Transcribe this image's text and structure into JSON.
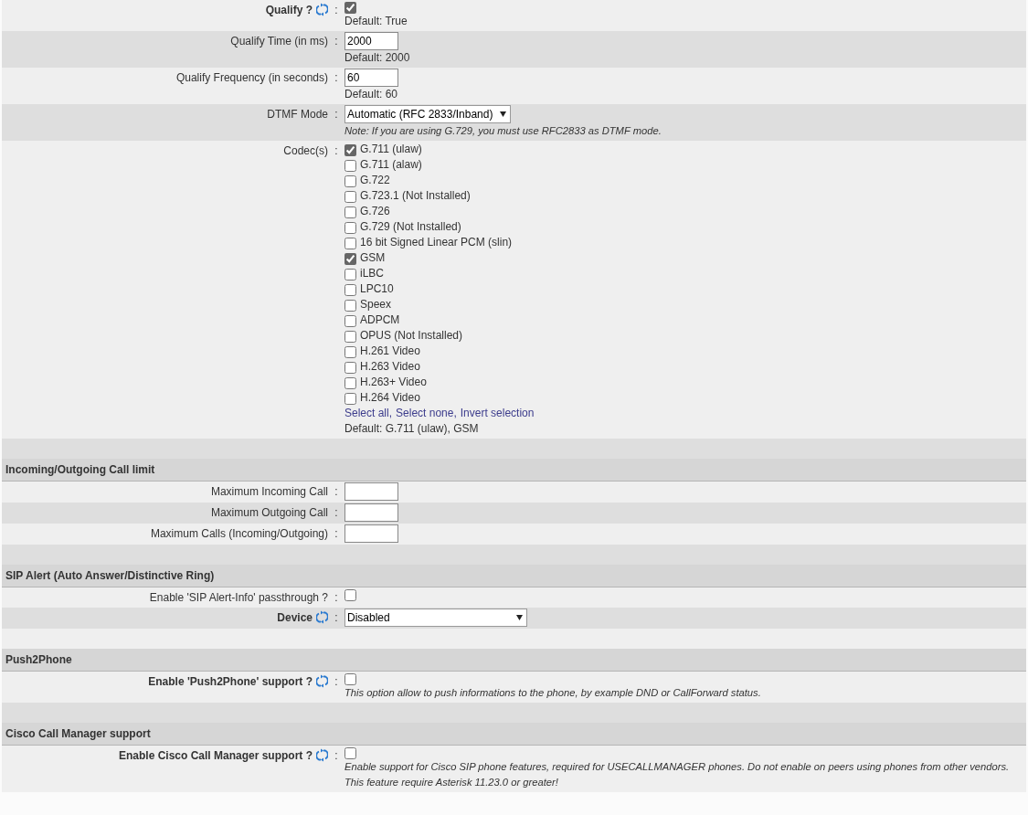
{
  "sections": [
    {
      "rows": [
        {
          "kind": "checkbox",
          "label": "Qualify ?",
          "bold": true,
          "refresh": true,
          "colon": ":",
          "checked": true,
          "hint": "Default: True"
        },
        {
          "kind": "text",
          "label": "Qualify Time (in ms)",
          "colon": ":",
          "value": "2000",
          "hint": "Default: 2000"
        },
        {
          "kind": "text",
          "label": "Qualify Frequency (in seconds)",
          "colon": ":",
          "value": "60",
          "hint": "Default: 60"
        },
        {
          "kind": "select",
          "label": "DTMF Mode",
          "colon": ":",
          "value": "Automatic (RFC 2833/Inband)",
          "notes": [
            "Note: If you are using G.729, you must use RFC2833 as DTMF mode."
          ]
        },
        {
          "kind": "checklist",
          "label": "Codec(s)",
          "colon": ":",
          "options": [
            {
              "label": "G.711 (ulaw)",
              "checked": true
            },
            {
              "label": "G.711 (alaw)",
              "checked": false
            },
            {
              "label": "G.722",
              "checked": false
            },
            {
              "label": "G.723.1 (Not Installed)",
              "checked": false
            },
            {
              "label": "G.726",
              "checked": false
            },
            {
              "label": "G.729 (Not Installed)",
              "checked": false
            },
            {
              "label": "16 bit Signed Linear PCM (slin)",
              "checked": false
            },
            {
              "label": "GSM",
              "checked": true
            },
            {
              "label": "iLBC",
              "checked": false
            },
            {
              "label": "LPC10",
              "checked": false
            },
            {
              "label": "Speex",
              "checked": false
            },
            {
              "label": "ADPCM",
              "checked": false
            },
            {
              "label": "OPUS (Not Installed)",
              "checked": false
            },
            {
              "label": "H.261 Video",
              "checked": false
            },
            {
              "label": "H.263 Video",
              "checked": false
            },
            {
              "label": "H.263+ Video",
              "checked": false
            },
            {
              "label": "H.264 Video",
              "checked": false
            }
          ],
          "links": [
            "Select all,",
            "Select none,",
            "Invert selection"
          ],
          "hint": "Default: G.711 (ulaw), GSM"
        },
        {
          "kind": "spacer"
        }
      ]
    },
    {
      "title": "Incoming/Outgoing Call limit",
      "rows": [
        {
          "kind": "text",
          "label": "Maximum Incoming Call",
          "colon": ":"
        },
        {
          "kind": "text",
          "label": "Maximum Outgoing Call",
          "colon": ":"
        },
        {
          "kind": "text",
          "label": "Maximum Calls (Incoming/Outgoing)",
          "colon": ":"
        },
        {
          "kind": "spacer"
        }
      ]
    },
    {
      "title": "SIP Alert (Auto Answer/Distinctive Ring)",
      "rows": [
        {
          "kind": "checkbox",
          "label": "Enable 'SIP Alert-Info' passthrough ?",
          "colon": ":",
          "checked": false
        },
        {
          "kind": "select",
          "label": "Device",
          "bold": true,
          "refresh": true,
          "colon": ":",
          "value": "Disabled",
          "wide": true
        },
        {
          "kind": "spacer"
        }
      ]
    },
    {
      "title": "Push2Phone",
      "rows": [
        {
          "kind": "checkbox",
          "label": "Enable 'Push2Phone' support ?",
          "bold": true,
          "refresh": true,
          "colon": ":",
          "checked": false,
          "notes": [
            "This option allow to push informations to the phone, by example DND or CallForward status."
          ]
        },
        {
          "kind": "spacer"
        }
      ]
    },
    {
      "title": "Cisco Call Manager support",
      "rows": [
        {
          "kind": "checkbox",
          "label": "Enable Cisco Call Manager support ?",
          "bold": true,
          "refresh": true,
          "colon": ":",
          "checked": false,
          "notes": [
            "Enable support for Cisco SIP phone features, required for USECALLMANAGER phones. Do not enable on peers using phones from other vendors.",
            "This feature require Asterisk 11.23.0 or greater!"
          ]
        }
      ]
    }
  ]
}
